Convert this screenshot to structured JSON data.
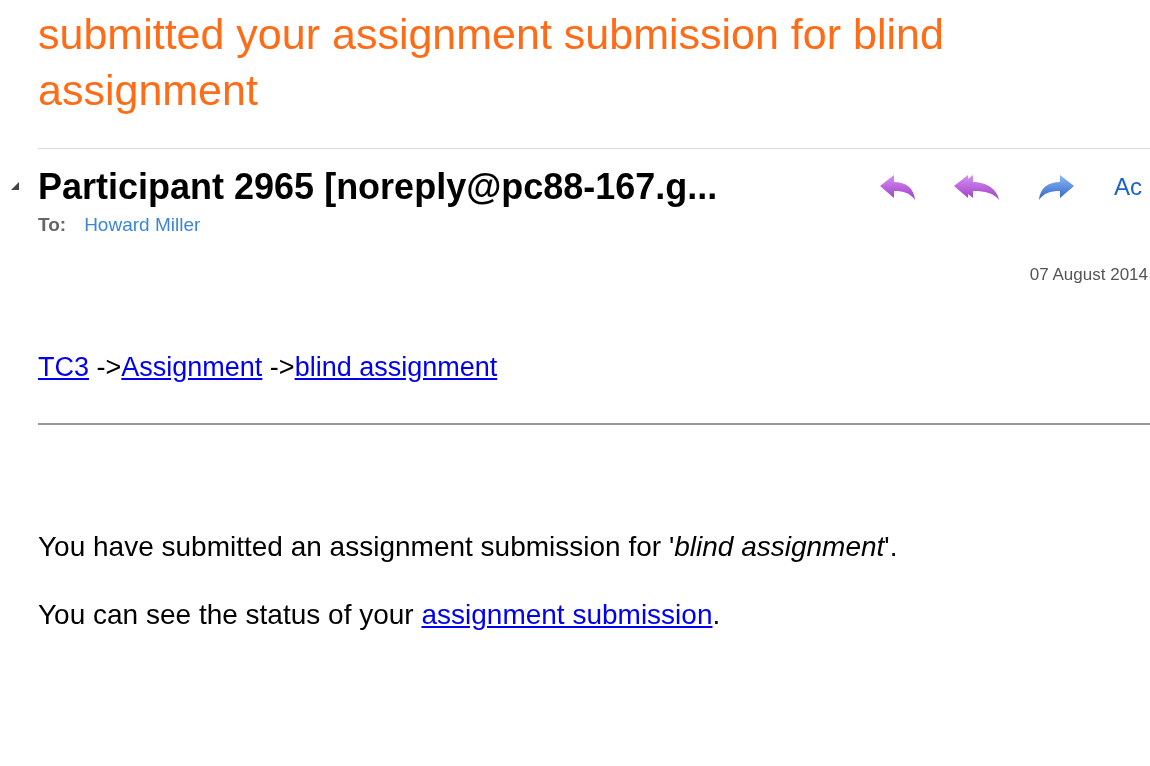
{
  "subject": "submitted your assignment submission for blind assignment",
  "message": {
    "expanded": true,
    "sender": "Participant 2965 [noreply@pc88-167.g...",
    "to_label": "To:",
    "recipient": "Howard Miller",
    "actions": [
      {
        "kind": "reply"
      },
      {
        "kind": "reply_all"
      },
      {
        "kind": "forward"
      }
    ],
    "action_link": "Ac",
    "date": "07 August 2014"
  },
  "breadcrumb": [
    {
      "kind": "link",
      "text": "TC3"
    },
    {
      "kind": "text",
      "text": " ->"
    },
    {
      "kind": "link",
      "text": "Assignment"
    },
    {
      "kind": "text",
      "text": " ->"
    },
    {
      "kind": "link",
      "text": "blind assignment"
    }
  ],
  "paragraphs": [
    [
      {
        "kind": "text",
        "text": "You have submitted an assignment submission for '*blind assignment*'."
      }
    ],
    [
      {
        "kind": "text",
        "text": "You can see the status of your "
      },
      {
        "kind": "link",
        "text": "assignment submission"
      },
      {
        "kind": "text",
        "text": "."
      }
    ]
  ]
}
